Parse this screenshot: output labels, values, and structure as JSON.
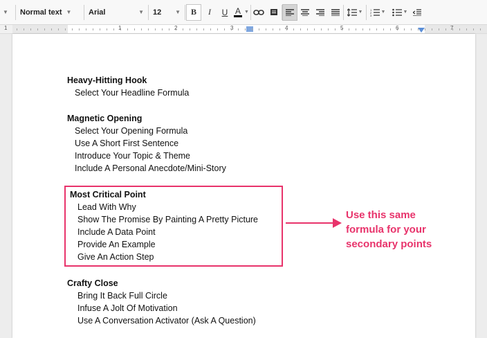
{
  "toolbar": {
    "style": "Normal text",
    "font": "Arial",
    "size": "12",
    "bold": "B",
    "italic": "I",
    "underline": "U",
    "text_color": "A"
  },
  "ruler": {
    "numbers": [
      "1",
      "1",
      "2",
      "3",
      "4",
      "5",
      "6",
      "7"
    ]
  },
  "document": {
    "sections": [
      {
        "heading": "Heavy-Hitting Hook",
        "items": [
          "Select Your Headline Formula"
        ]
      },
      {
        "heading": "Magnetic Opening",
        "items": [
          "Select Your Opening Formula",
          "Use A Short First Sentence",
          "Introduce Your Topic & Theme",
          "Include A Personal Anecdote/Mini-Story"
        ]
      },
      {
        "heading": "Most Critical Point",
        "items": [
          "Lead With Why",
          "Show The Promise By Painting A Pretty Picture",
          "Include A Data Point",
          "Provide An Example",
          "Give An Action Step"
        ]
      },
      {
        "heading": "Crafty Close",
        "items": [
          "Bring It Back Full Circle",
          "Infuse A Jolt Of Motivation",
          "Use A Conversation Activator (Ask A Question)"
        ]
      }
    ]
  },
  "annotation": {
    "lines": [
      "Use this same",
      "formula for your",
      "secondary points"
    ],
    "color": "#e8336b"
  }
}
